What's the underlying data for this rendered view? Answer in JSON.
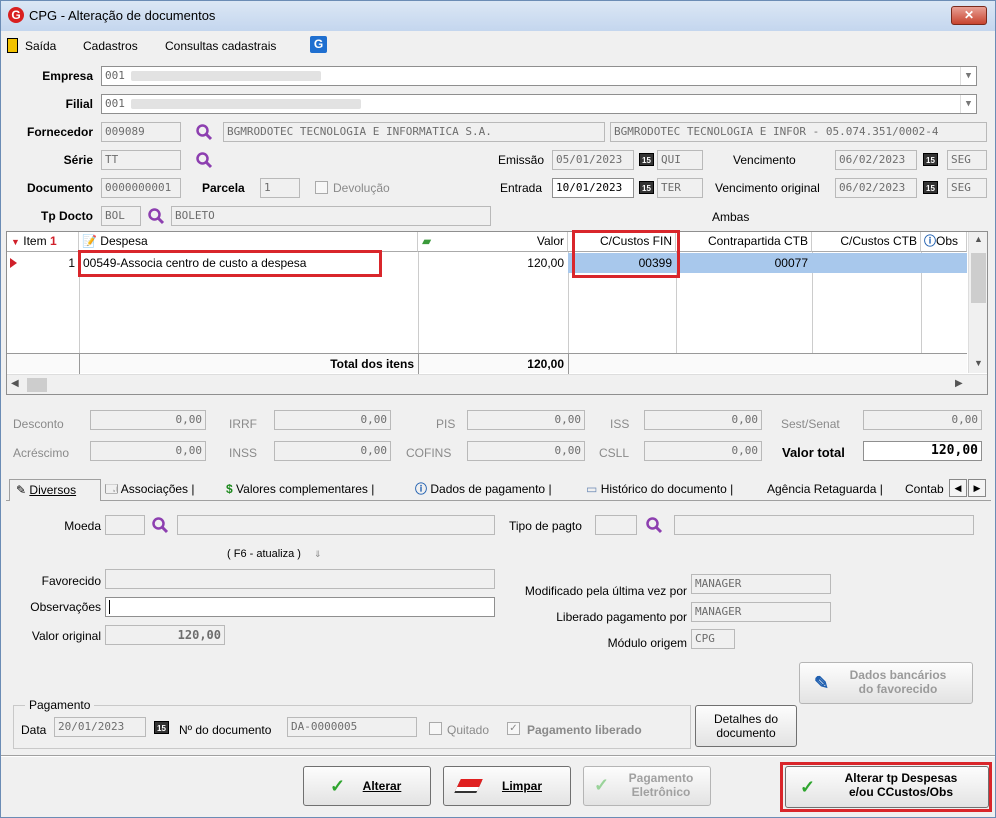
{
  "window": {
    "title": "CPG - Alteração de documentos"
  },
  "menu": [
    "Saída",
    "Cadastros",
    "Consultas cadastrais"
  ],
  "header": {
    "empresa_label": "Empresa",
    "empresa_value": "001",
    "filial_label": "Filial",
    "filial_value": "001",
    "fornecedor_label": "Fornecedor",
    "fornecedor_code": "009089",
    "fornecedor_name": "BGMRODOTEC TECNOLOGIA E INFORMATICA S.A.",
    "fornecedor_full": "BGMRODOTEC TECNOLOGIA E INFOR - 05.074.351/0002-4",
    "serie_label": "Série",
    "serie_value": "TT",
    "documento_label": "Documento",
    "documento_value": "0000000001",
    "parcela_label": "Parcela",
    "parcela_value": "1",
    "devolucao_label": "Devolução",
    "tpdocto_label": "Tp Docto",
    "tpdocto_code": "BOL",
    "tpdocto_name": "BOLETO",
    "emissao_label": "Emissão",
    "emissao_value": "05/01/2023",
    "emissao_day": "QUI",
    "entrada_label": "Entrada",
    "entrada_value": "10/01/2023",
    "entrada_day": "TER",
    "vencimento_label": "Vencimento",
    "vencimento_value": "06/02/2023",
    "vencimento_day": "SEG",
    "venc_orig_label": "Vencimento original",
    "venc_orig_value": "06/02/2023",
    "venc_orig_day": "SEG",
    "ambas": "Ambas"
  },
  "grid": {
    "headers": {
      "item": "Item",
      "despesa": "Despesa",
      "valor": "Valor",
      "ccustos_fin": "C/Custos FIN",
      "contrapartida": "Contrapartida CTB",
      "ccustos_ctb": "C/Custos CTB",
      "obs": "Obs"
    },
    "row": {
      "item": "1",
      "despesa": "00549-Associa centro de custo a despesa",
      "valor": "120,00",
      "ccustos_fin": "00399",
      "contrapartida": "00077"
    },
    "total_label": "Total dos itens",
    "total_value": "120,00"
  },
  "totals": {
    "desconto_label": "Desconto",
    "desconto": "0,00",
    "irrf_label": "IRRF",
    "irrf": "0,00",
    "pis_label": "PIS",
    "pis": "0,00",
    "iss_label": "ISS",
    "iss": "0,00",
    "sest_label": "Sest/Senat",
    "sest": "0,00",
    "acrescimo_label": "Acréscimo",
    "acrescimo": "0,00",
    "inss_label": "INSS",
    "inss": "0,00",
    "cofins_label": "COFINS",
    "cofins": "0,00",
    "csll_label": "CSLL",
    "csll": "0,00",
    "valor_total_label": "Valor total",
    "valor_total": "120,00"
  },
  "tabs": [
    "Diversos",
    "Associações",
    "Valores complementares",
    "Dados de pagamento",
    "Histórico do documento",
    "Agência Retaguarda",
    "Contab"
  ],
  "diversos": {
    "moeda_label": "Moeda",
    "tipo_pagto_label": "Tipo de pagto",
    "f6_hint": "( F6 - atualiza )",
    "favorecido_label": "Favorecido",
    "observacoes_label": "Observações",
    "valor_original_label": "Valor original",
    "valor_original": "120,00",
    "modificado_label": "Modificado pela última vez por",
    "modificado": "MANAGER",
    "liberado_label": "Liberado pagamento por",
    "liberado": "MANAGER",
    "modulo_label": "Módulo origem",
    "modulo": "CPG",
    "dados_bancarios_1": "Dados bancários",
    "dados_bancarios_2": "do favorecido",
    "pagamento_legend": "Pagamento",
    "data_label": "Data",
    "data": "20/01/2023",
    "ndoc_label": "Nº do documento",
    "ndoc": "DA-0000005",
    "quitado_label": "Quitado",
    "pag_liberado_label": "Pagamento liberado",
    "detalhes_1": "Detalhes do",
    "detalhes_2": "documento"
  },
  "buttons": {
    "alterar": "Alterar",
    "limpar": "Limpar",
    "pag_eletronico_1": "Pagamento",
    "pag_eletronico_2": "Eletrônico",
    "alterar_tp_1": "Alterar tp Despesas",
    "alterar_tp_2": "e/ou CCustos/Obs"
  }
}
